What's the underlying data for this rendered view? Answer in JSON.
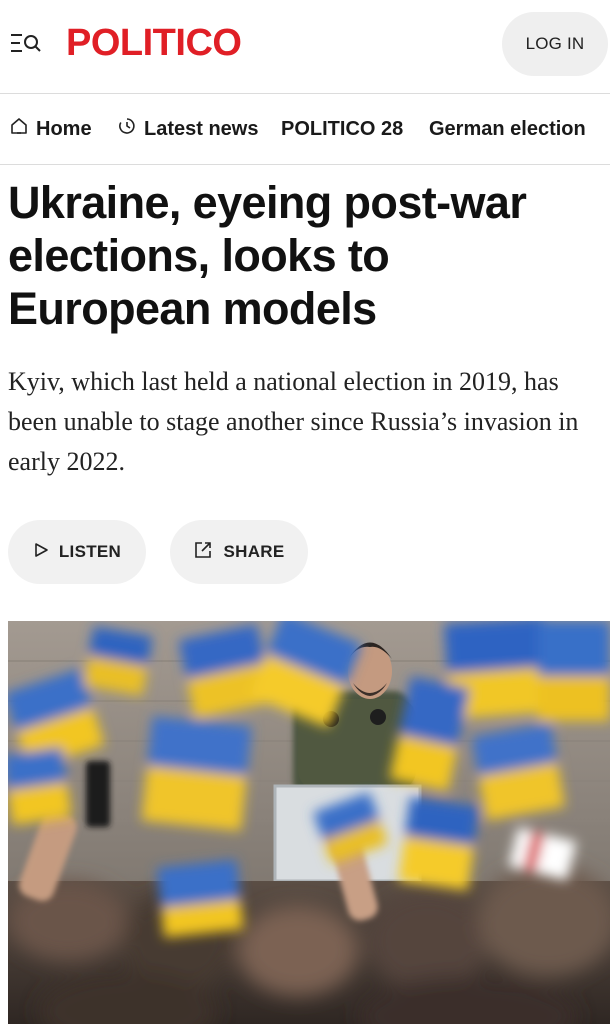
{
  "header": {
    "logo": "POLITICO",
    "login_label": "LOG IN",
    "menu_icon": "menu-search-icon",
    "brand_color": "#e01f26"
  },
  "nav": {
    "items": [
      {
        "label": "Home",
        "icon": "home-icon"
      },
      {
        "label": "Latest news",
        "icon": "clock-icon"
      },
      {
        "label": "POLITICO 28"
      },
      {
        "label": "German election"
      }
    ]
  },
  "article": {
    "headline": "Ukraine, eyeing post-war elections, looks to European models",
    "dek": "Kyiv, which last held a national election in 2019, has been unable to stage another since Russia’s invasion in early 2022.",
    "listen_label": "LISTEN",
    "share_label": "SHARE"
  }
}
